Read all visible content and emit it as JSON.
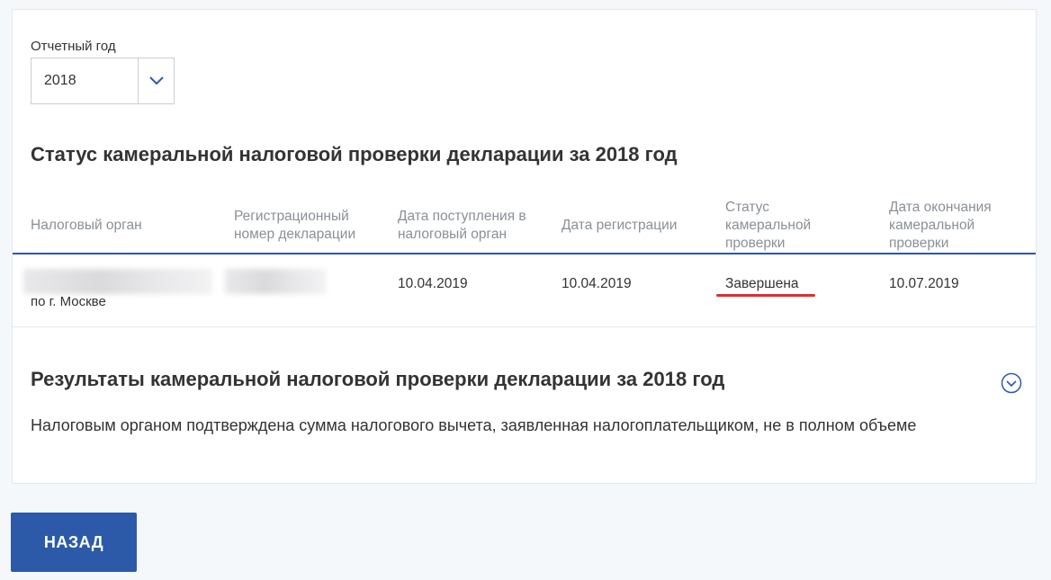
{
  "filter": {
    "year_label": "Отчетный год",
    "year_value": "2018",
    "chevron_icon": "chevron-down-icon"
  },
  "status_section": {
    "title": "Статус камеральной налоговой проверки декларации за 2018 год",
    "columns": [
      "Налоговый орган",
      "Регистрационный номер декларации",
      "Дата поступления в налоговый орган",
      "Дата регистрации",
      "Статус камеральной проверки",
      "Дата окончания камеральной проверки"
    ],
    "row": {
      "tax_authority_suffix": "по г. Москве",
      "received_date": "10.04.2019",
      "registration_date": "10.04.2019",
      "status": "Завершена",
      "end_date": "10.07.2019"
    }
  },
  "results_section": {
    "title": "Результаты камеральной налоговой проверки декларации за 2018 год",
    "text": "Налоговым органом подтверждена сумма налогового вычета, заявленная налогоплательщиком, не в полном объеме",
    "toggle_icon": "chevron-circle-down-icon"
  },
  "actions": {
    "back_label": "НАЗАД"
  },
  "colors": {
    "accent": "#2c5aa8",
    "status_highlight": "#e12d2d",
    "header_text": "#8a9097"
  }
}
